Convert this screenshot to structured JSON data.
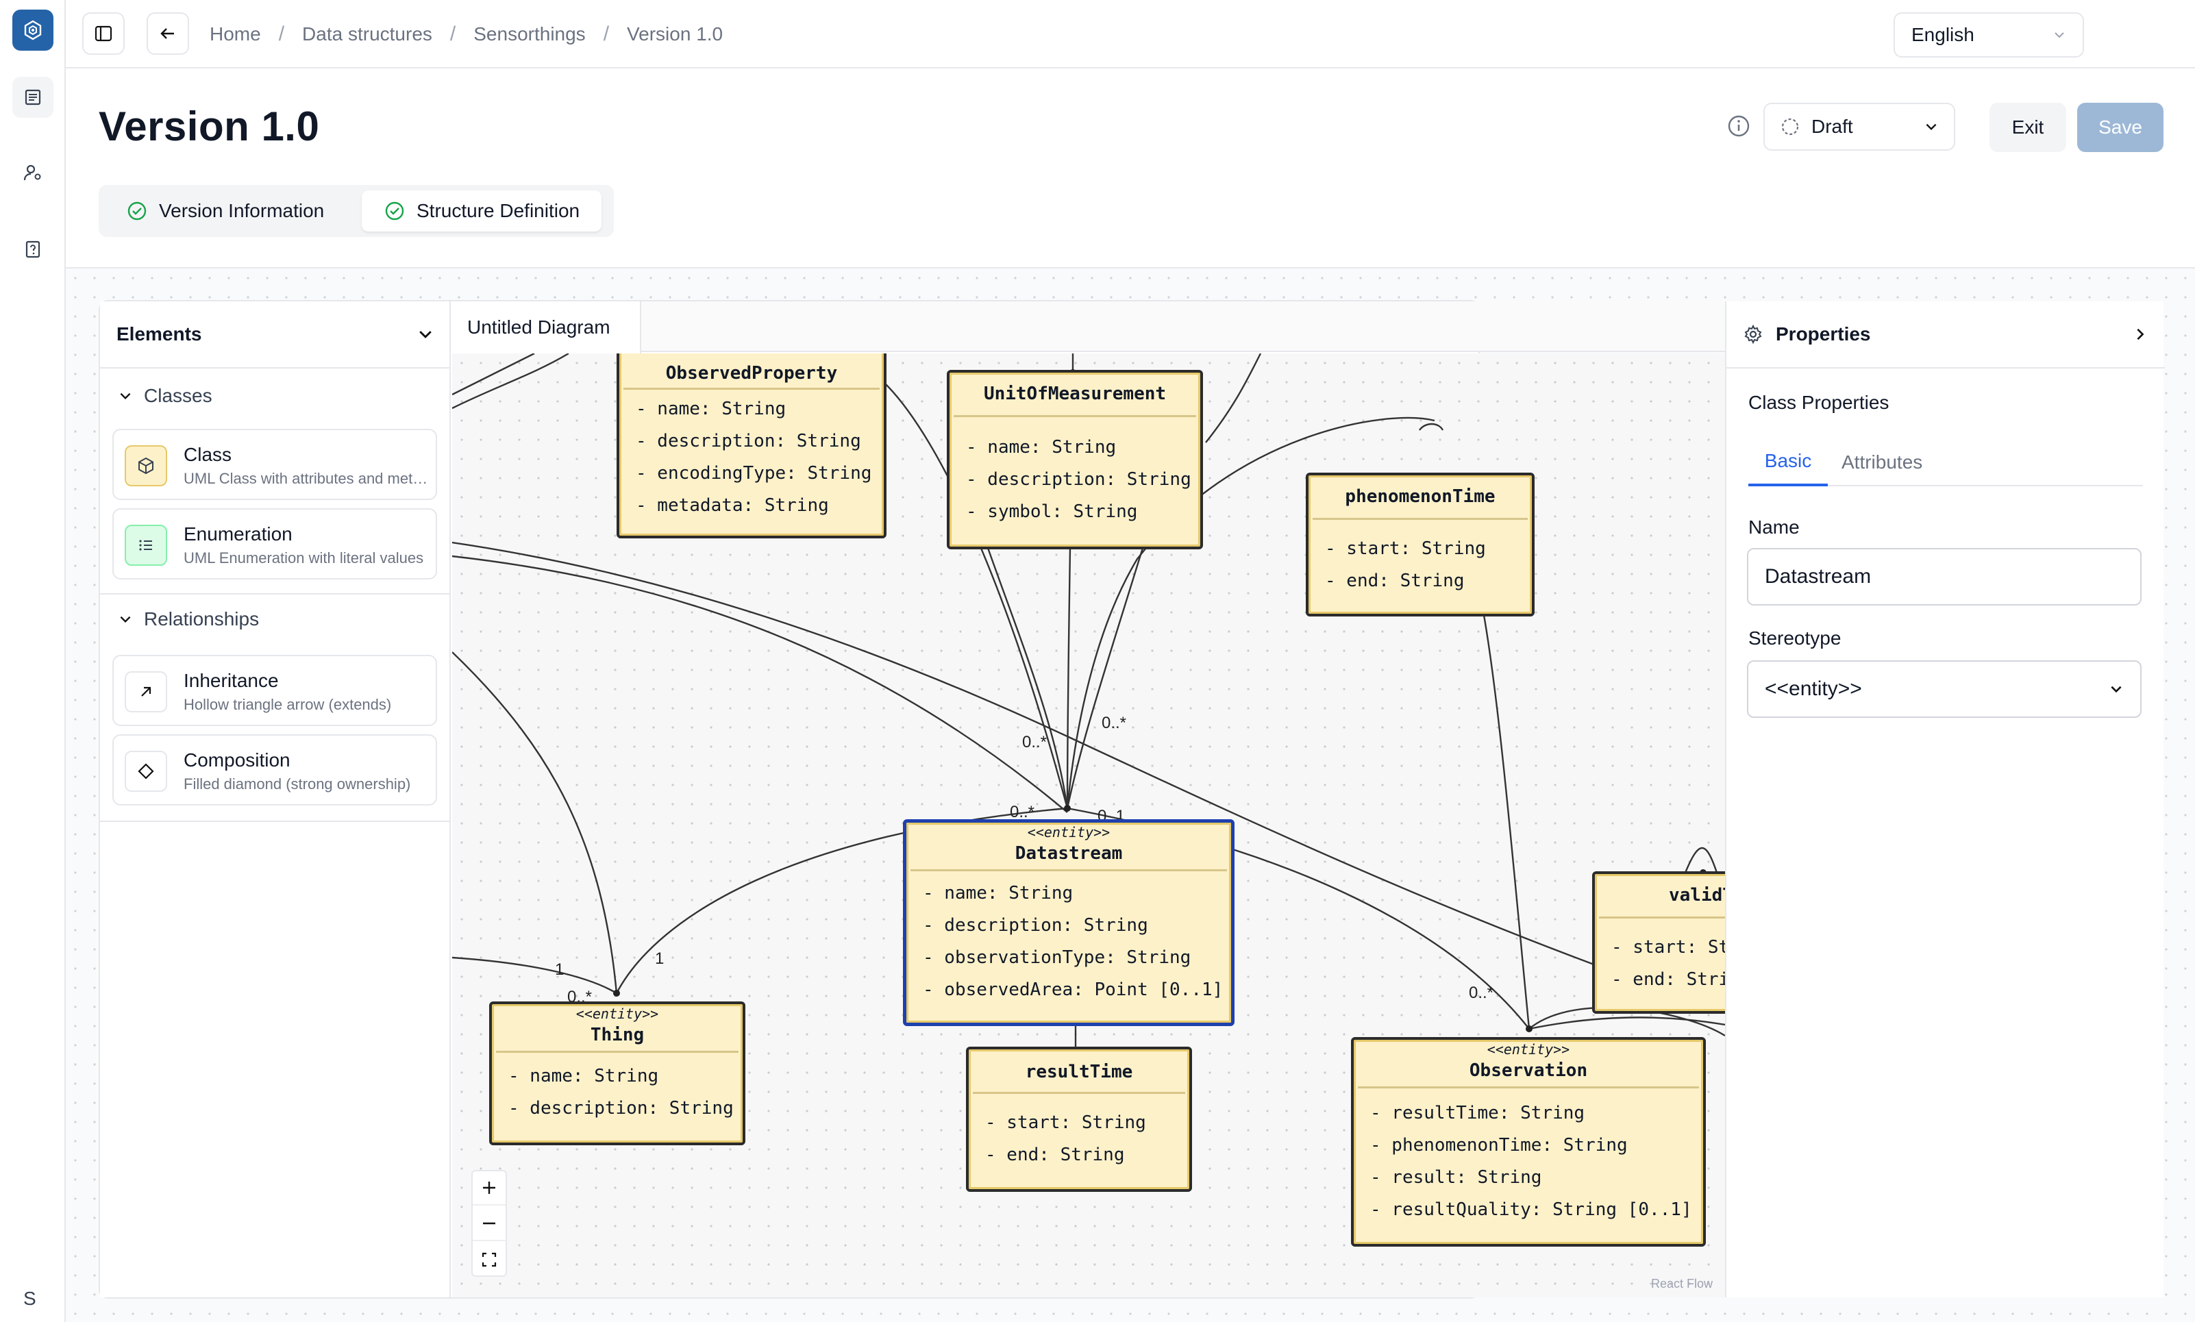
{
  "app": {
    "logo_letter": "S"
  },
  "breadcrumb": [
    "Home",
    "Data structures",
    "Sensorthings",
    "Version 1.0"
  ],
  "language": {
    "selected": "English"
  },
  "page": {
    "title": "Version 1.0",
    "status": "Draft",
    "exit_label": "Exit",
    "save_label": "Save"
  },
  "tabs": [
    {
      "label": "Version Information",
      "active": false
    },
    {
      "label": "Structure Definition",
      "active": true
    }
  ],
  "elements_panel": {
    "title": "Elements",
    "classes_heading": "Classes",
    "classes": [
      {
        "title": "Class",
        "desc": "UML Class with attributes and methods"
      },
      {
        "title": "Enumeration",
        "desc": "UML Enumeration with literal values"
      }
    ],
    "relationships_heading": "Relationships",
    "relationships": [
      {
        "title": "Inheritance",
        "desc": "Hollow triangle arrow (extends)"
      },
      {
        "title": "Composition",
        "desc": "Filled diamond (strong ownership)"
      }
    ]
  },
  "diagram": {
    "tab_label": "Untitled Diagram",
    "attribution": "React Flow",
    "nodes": [
      {
        "id": "observedproperty",
        "name": "ObservedProperty",
        "stereotype": "",
        "attributes": [
          "- name: String",
          "- description: String",
          "- encodingType: String",
          "- metadata: String"
        ]
      },
      {
        "id": "unitofmeasurement",
        "name": "UnitOfMeasurement",
        "stereotype": "",
        "attributes": [
          "- name: String",
          "- description: String",
          "- symbol: String"
        ]
      },
      {
        "id": "phenomenontime",
        "name": "phenomenonTime",
        "stereotype": "",
        "attributes": [
          "- start: String",
          "- end: String"
        ]
      },
      {
        "id": "datastream",
        "name": "Datastream",
        "stereotype": "<<entity>>",
        "attributes": [
          "- name: String",
          "- description: String",
          "- observationType: String",
          "- observedArea: Point [0..1]"
        ]
      },
      {
        "id": "thing",
        "name": "Thing",
        "stereotype": "<<entity>>",
        "attributes": [
          "- name: String",
          "- description: String"
        ]
      },
      {
        "id": "resulttime",
        "name": "resultTime",
        "stereotype": "",
        "attributes": [
          "- start: String",
          "- end: String"
        ]
      },
      {
        "id": "observation",
        "name": "Observation",
        "stereotype": "<<entity>>",
        "attributes": [
          "- resultTime: String",
          "- phenomenonTime: String",
          "- result: String",
          "- resultQuality: String [0..1]"
        ]
      },
      {
        "id": "validtime",
        "name": "validTi",
        "stereotype": "",
        "attributes": [
          "- start: St",
          "- end: Stri"
        ]
      }
    ],
    "multiplicities": [
      "0..*",
      "0..*",
      "0..*",
      "0..1",
      "1",
      "1",
      "0..*",
      "0..*"
    ]
  },
  "properties_panel": {
    "title": "Properties",
    "section": "Class Properties",
    "tabs": [
      "Basic",
      "Attributes"
    ],
    "name_label": "Name",
    "name_value": "Datastream",
    "stereotype_label": "Stereotype",
    "stereotype_value": "<<entity>>"
  }
}
